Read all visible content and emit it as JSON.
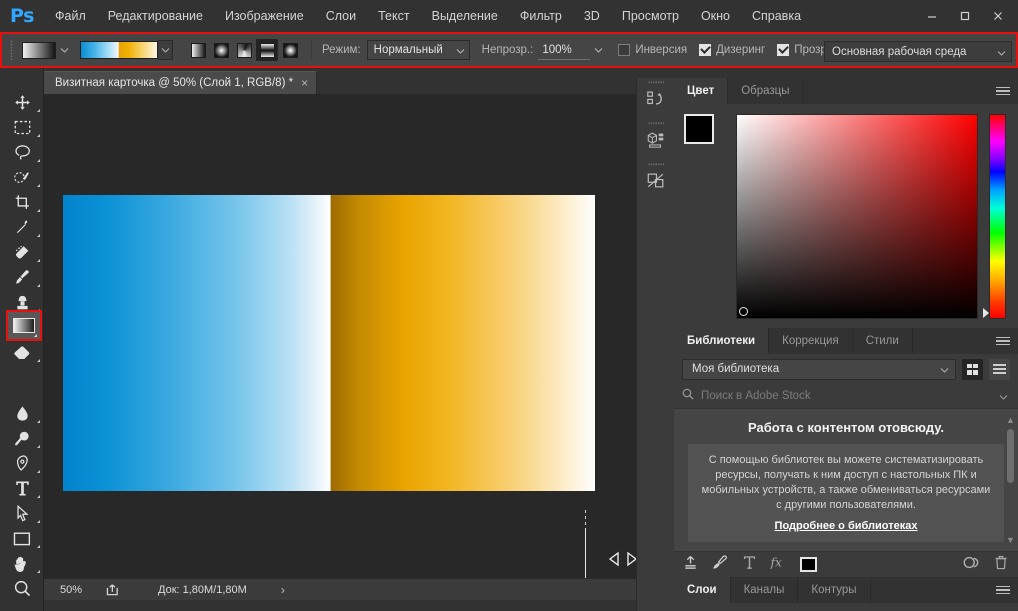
{
  "app": {
    "logo": "Ps",
    "window_buttons": [
      "minimize",
      "maximize",
      "close"
    ]
  },
  "menubar": {
    "items": [
      {
        "label": "Файл"
      },
      {
        "label": "Редактирование"
      },
      {
        "label": "Изображение"
      },
      {
        "label": "Слои"
      },
      {
        "label": "Текст"
      },
      {
        "label": "Выделение"
      },
      {
        "label": "Фильтр"
      },
      {
        "label": "3D"
      },
      {
        "label": "Просмотр"
      },
      {
        "label": "Окно"
      },
      {
        "label": "Справка"
      }
    ]
  },
  "options_bar": {
    "highlighted": true,
    "highlight_color": "#e8100f",
    "gradient_preset_swatch": "linear-white-to-black",
    "gradient_preview": "blue-to-white-orange-to-white",
    "gradient_types": [
      {
        "name": "linear",
        "active": false
      },
      {
        "name": "radial",
        "active": false
      },
      {
        "name": "angle",
        "active": false
      },
      {
        "name": "reflected",
        "active": true
      },
      {
        "name": "diamond",
        "active": false
      }
    ],
    "mode_label": "Режим:",
    "mode_value": "Нормальный",
    "opacity_label": "Непрозр.:",
    "opacity_value": "100%",
    "checkboxes": [
      {
        "label": "Инверсия",
        "checked": false
      },
      {
        "label": "Дизеринг",
        "checked": true
      },
      {
        "label": "Прозрачност",
        "checked": true
      }
    ],
    "workspace": "Основная рабочая среда"
  },
  "document_tab": {
    "title": "Визитная карточка @ 50% (Слой 1, RGB/8) *",
    "close": "×"
  },
  "toolbar": {
    "tools": [
      {
        "name": "move-tool",
        "has_flyout": true
      },
      {
        "name": "rectangular-marquee-tool",
        "has_flyout": true
      },
      {
        "name": "lasso-tool",
        "has_flyout": true
      },
      {
        "name": "quick-selection-tool",
        "has_flyout": true
      },
      {
        "name": "crop-tool",
        "has_flyout": true
      },
      {
        "name": "eyedropper-tool",
        "has_flyout": true
      },
      {
        "name": "spot-healing-brush-tool",
        "has_flyout": true
      },
      {
        "name": "brush-tool",
        "has_flyout": true
      },
      {
        "name": "clone-stamp-tool",
        "has_flyout": true
      },
      {
        "name": "history-brush-tool",
        "has_flyout": true
      },
      {
        "name": "eraser-tool",
        "has_flyout": true
      },
      {
        "name": "gradient-tool",
        "has_flyout": true,
        "selected": true,
        "highlighted": true
      },
      {
        "name": "blur-tool",
        "has_flyout": true
      },
      {
        "name": "dodge-tool",
        "has_flyout": true
      },
      {
        "name": "pen-tool",
        "has_flyout": true
      },
      {
        "name": "type-tool",
        "has_flyout": true
      },
      {
        "name": "path-selection-tool",
        "has_flyout": true
      },
      {
        "name": "rectangle-tool",
        "has_flyout": true
      },
      {
        "name": "hand-tool",
        "has_flyout": true
      },
      {
        "name": "zoom-tool",
        "has_flyout": false
      }
    ]
  },
  "canvas": {
    "artboard_gradient": "reflected blue-white / orange-white",
    "guide_visible": true,
    "cursor": "horizontal-resize"
  },
  "status_bar": {
    "zoom": "50%",
    "share_icon": "share-icon",
    "doc_info": "Док: 1,80M/1,80M",
    "arrow": "›"
  },
  "dock_icons": [
    {
      "name": "history-panel-icon"
    },
    {
      "name": "3d-panel-icon"
    },
    {
      "name": "properties-panel-icon"
    }
  ],
  "color_panel": {
    "tabs": [
      {
        "label": "Цвет",
        "active": true
      },
      {
        "label": "Образцы",
        "active": false
      }
    ],
    "foreground_color": "#000000",
    "background_color": "#ffffff",
    "field_base_hue": "#ff0000"
  },
  "libraries_panel": {
    "tabs": [
      {
        "label": "Библиотеки",
        "active": true
      },
      {
        "label": "Коррекция",
        "active": false
      },
      {
        "label": "Стили",
        "active": false
      }
    ],
    "library_select": "Моя библиотека",
    "view_buttons": [
      {
        "name": "grid-view",
        "active": true
      },
      {
        "name": "list-view",
        "active": false
      }
    ],
    "search_placeholder": "Поиск в Adobe Stock",
    "content_title": "Работа с контентом отовсюду.",
    "content_text": "С помощью библиотек вы можете систематизировать ресурсы, получать к ним доступ с настольных ПК и мобильных устройств, а также обмениваться ресурсами с другими пользователями.",
    "content_link": "Подробнее о библиотеках",
    "footer_icons": [
      {
        "name": "upload-icon"
      },
      {
        "name": "add-graphic-icon"
      },
      {
        "name": "add-text-style-icon"
      },
      {
        "name": "add-layer-style-icon"
      },
      {
        "name": "add-color-swatch-icon"
      },
      {
        "name": "creative-cloud-icon"
      },
      {
        "name": "delete-icon"
      }
    ],
    "footer_color_chip": "#000000"
  },
  "layers_panel": {
    "tabs": [
      {
        "label": "Слои",
        "active": true
      },
      {
        "label": "Каналы",
        "active": false
      },
      {
        "label": "Контуры",
        "active": false
      }
    ]
  }
}
